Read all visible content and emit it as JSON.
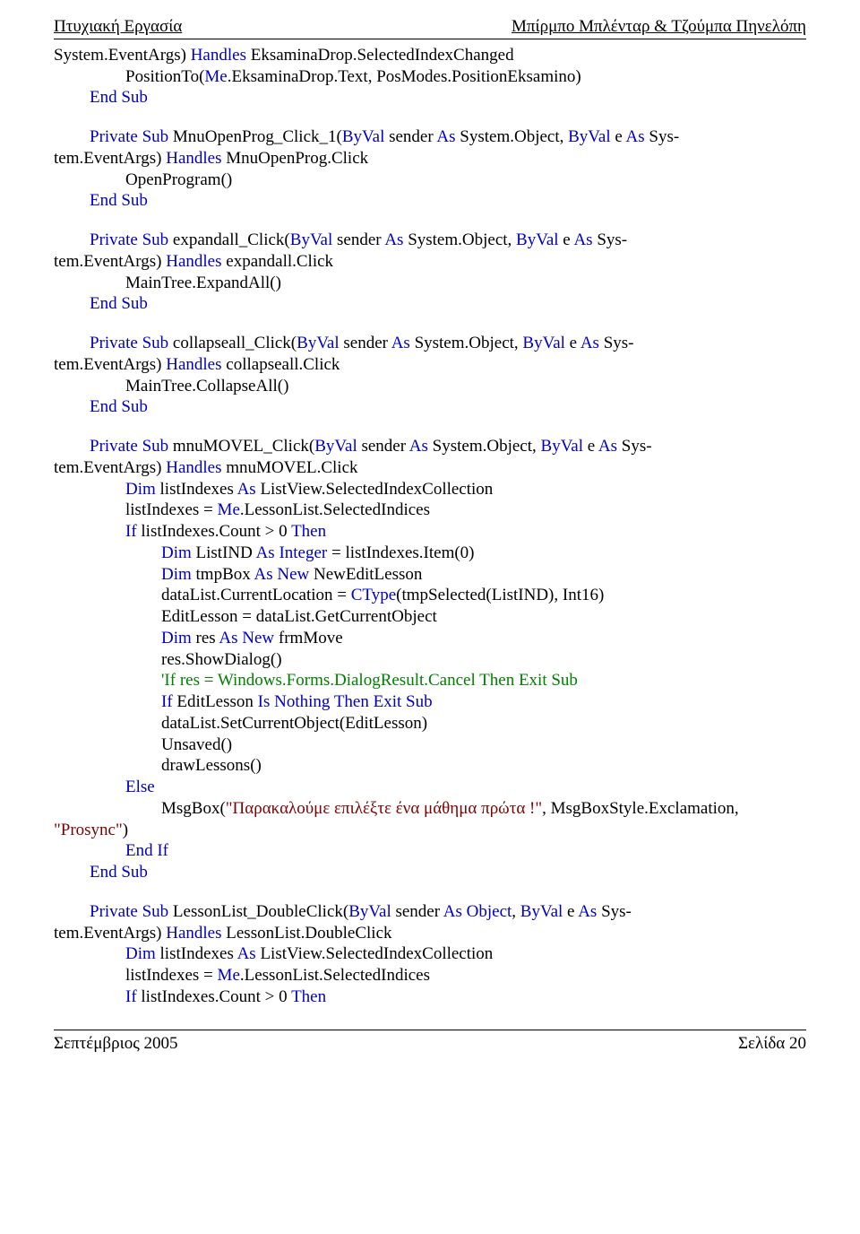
{
  "header": {
    "left": "Πτυχιακή Εργασία",
    "right": "Μπίρμπο Μπλένταρ & Τζούμπα Πηνελόπη"
  },
  "footer": {
    "left": "Σεπτέμβριος 2005",
    "right": "Σελίδα 20"
  },
  "p1": {
    "t1": "System.EventArgs) ",
    "t2": "Handles",
    "t3": " EksaminaDrop.SelectedIndexChanged",
    "t4": "PositionTo(",
    "t5": "Me",
    "t6": ".EksaminaDrop.Text, PosModes.PositionEksamino)",
    "t7": "End",
    "t8": " Sub"
  },
  "p2": {
    "t1": "Private",
    "t2": " Sub",
    "t3": " MnuOpenProg_Click_1(",
    "t4": "ByVal",
    "t5": " sender ",
    "t6": "As",
    "t7": " System.Object, ",
    "t8": "ByVal",
    "t9": " e ",
    "t10": "As",
    "t11": " Sys-",
    "t12": "tem.EventArgs) ",
    "t13": "Handles",
    "t14": " MnuOpenProg.Click",
    "t15": "OpenProgram()",
    "t16": "End",
    "t17": " Sub"
  },
  "p3": {
    "t1": "Private",
    "t2": " Sub",
    "t3": " expandall_Click(",
    "t4": "ByVal",
    "t5": " sender ",
    "t6": "As",
    "t7": " System.Object, ",
    "t8": "ByVal",
    "t9": " e ",
    "t10": "As",
    "t11": " Sys-",
    "t12": "tem.EventArgs) ",
    "t13": "Handles",
    "t14": " expandall.Click",
    "t15": "MainTree.ExpandAll()",
    "t16": "End",
    "t17": " Sub"
  },
  "p4": {
    "t1": "Private",
    "t2": " Sub",
    "t3": " collapseall_Click(",
    "t4": "ByVal",
    "t5": " sender ",
    "t6": "As",
    "t7": " System.Object, ",
    "t8": "ByVal",
    "t9": " e ",
    "t10": "As",
    "t11": " Sys-",
    "t12": "tem.EventArgs) ",
    "t13": "Handles",
    "t14": " collapseall.Click",
    "t15": "MainTree.CollapseAll()",
    "t16": "End",
    "t17": " Sub"
  },
  "p5": {
    "t1": "Private",
    "t2": " Sub",
    "t3": " mnuMOVEL_Click(",
    "t4": "ByVal",
    "t5": " sender ",
    "t6": "As",
    "t7": " System.Object, ",
    "t8": "ByVal",
    "t9": " e ",
    "t10": "As",
    "t11": " Sys-",
    "t12": "tem.EventArgs) ",
    "t13": "Handles",
    "t14": " mnuMOVEL.Click",
    "t15": "Dim",
    "t16": " listIndexes ",
    "t17": "As",
    "t18": " ListView.SelectedIndexCollection",
    "t19": "listIndexes = ",
    "t20": "Me",
    "t21": ".LessonList.SelectedIndices",
    "t22": "If",
    "t23": " listIndexes.Count > 0 ",
    "t24": "Then",
    "t25": "Dim",
    "t26": " ListIND ",
    "t27": "As",
    "t28": " Integer",
    "t29": " = listIndexes.Item(0)",
    "t30": "Dim",
    "t31": " tmpBox ",
    "t32": "As",
    "t33": " New",
    "t34": " NewEditLesson",
    "t35": "dataList.CurrentLocation = ",
    "t36": "CType",
    "t37": "(tmpSelected(ListIND), Int16)",
    "t38": "EditLesson = dataList.GetCurrentObject",
    "t39": "Dim",
    "t40": " res ",
    "t41": "As",
    "t42": " New",
    "t43": " frmMove",
    "t44": "res.ShowDialog()",
    "t45": "'If res = Windows.Forms.DialogResult.Cancel Then Exit Sub",
    "t46": "If",
    "t47": " EditLesson ",
    "t48": "Is",
    "t49": " Nothing",
    "t50": " Then",
    "t51": " Exit",
    "t52": " Sub",
    "t53": "dataList.SetCurrentObject(EditLesson)",
    "t54": "Unsaved()",
    "t55": "drawLessons()",
    "t56": "Else",
    "t57": "MsgBox(",
    "t58": "\"Παρακαλούμε επιλέξτε ένα μάθημα πρώτα !\"",
    "t59": ", MsgBoxStyle.Exclamation,",
    "t60": "\"Prosync\"",
    "t61": ")",
    "t62": "End",
    "t63": " If",
    "t64": "End",
    "t65": " Sub"
  },
  "p6": {
    "t1": "Private",
    "t2": " Sub",
    "t3": " LessonList_DoubleClick(",
    "t4": "ByVal",
    "t5": " sender ",
    "t6": "As",
    "t7": " Object",
    "t8": ", ",
    "t9": "ByVal",
    "t10": " e ",
    "t11": "As",
    "t12": " Sys-",
    "t13": "tem.EventArgs) ",
    "t14": "Handles",
    "t15": " LessonList.DoubleClick",
    "t16": "Dim",
    "t17": " listIndexes ",
    "t18": "As",
    "t19": " ListView.SelectedIndexCollection",
    "t20": "listIndexes = ",
    "t21": "Me",
    "t22": ".LessonList.SelectedIndices",
    "t23": "If",
    "t24": " listIndexes.Count > 0 ",
    "t25": "Then"
  }
}
